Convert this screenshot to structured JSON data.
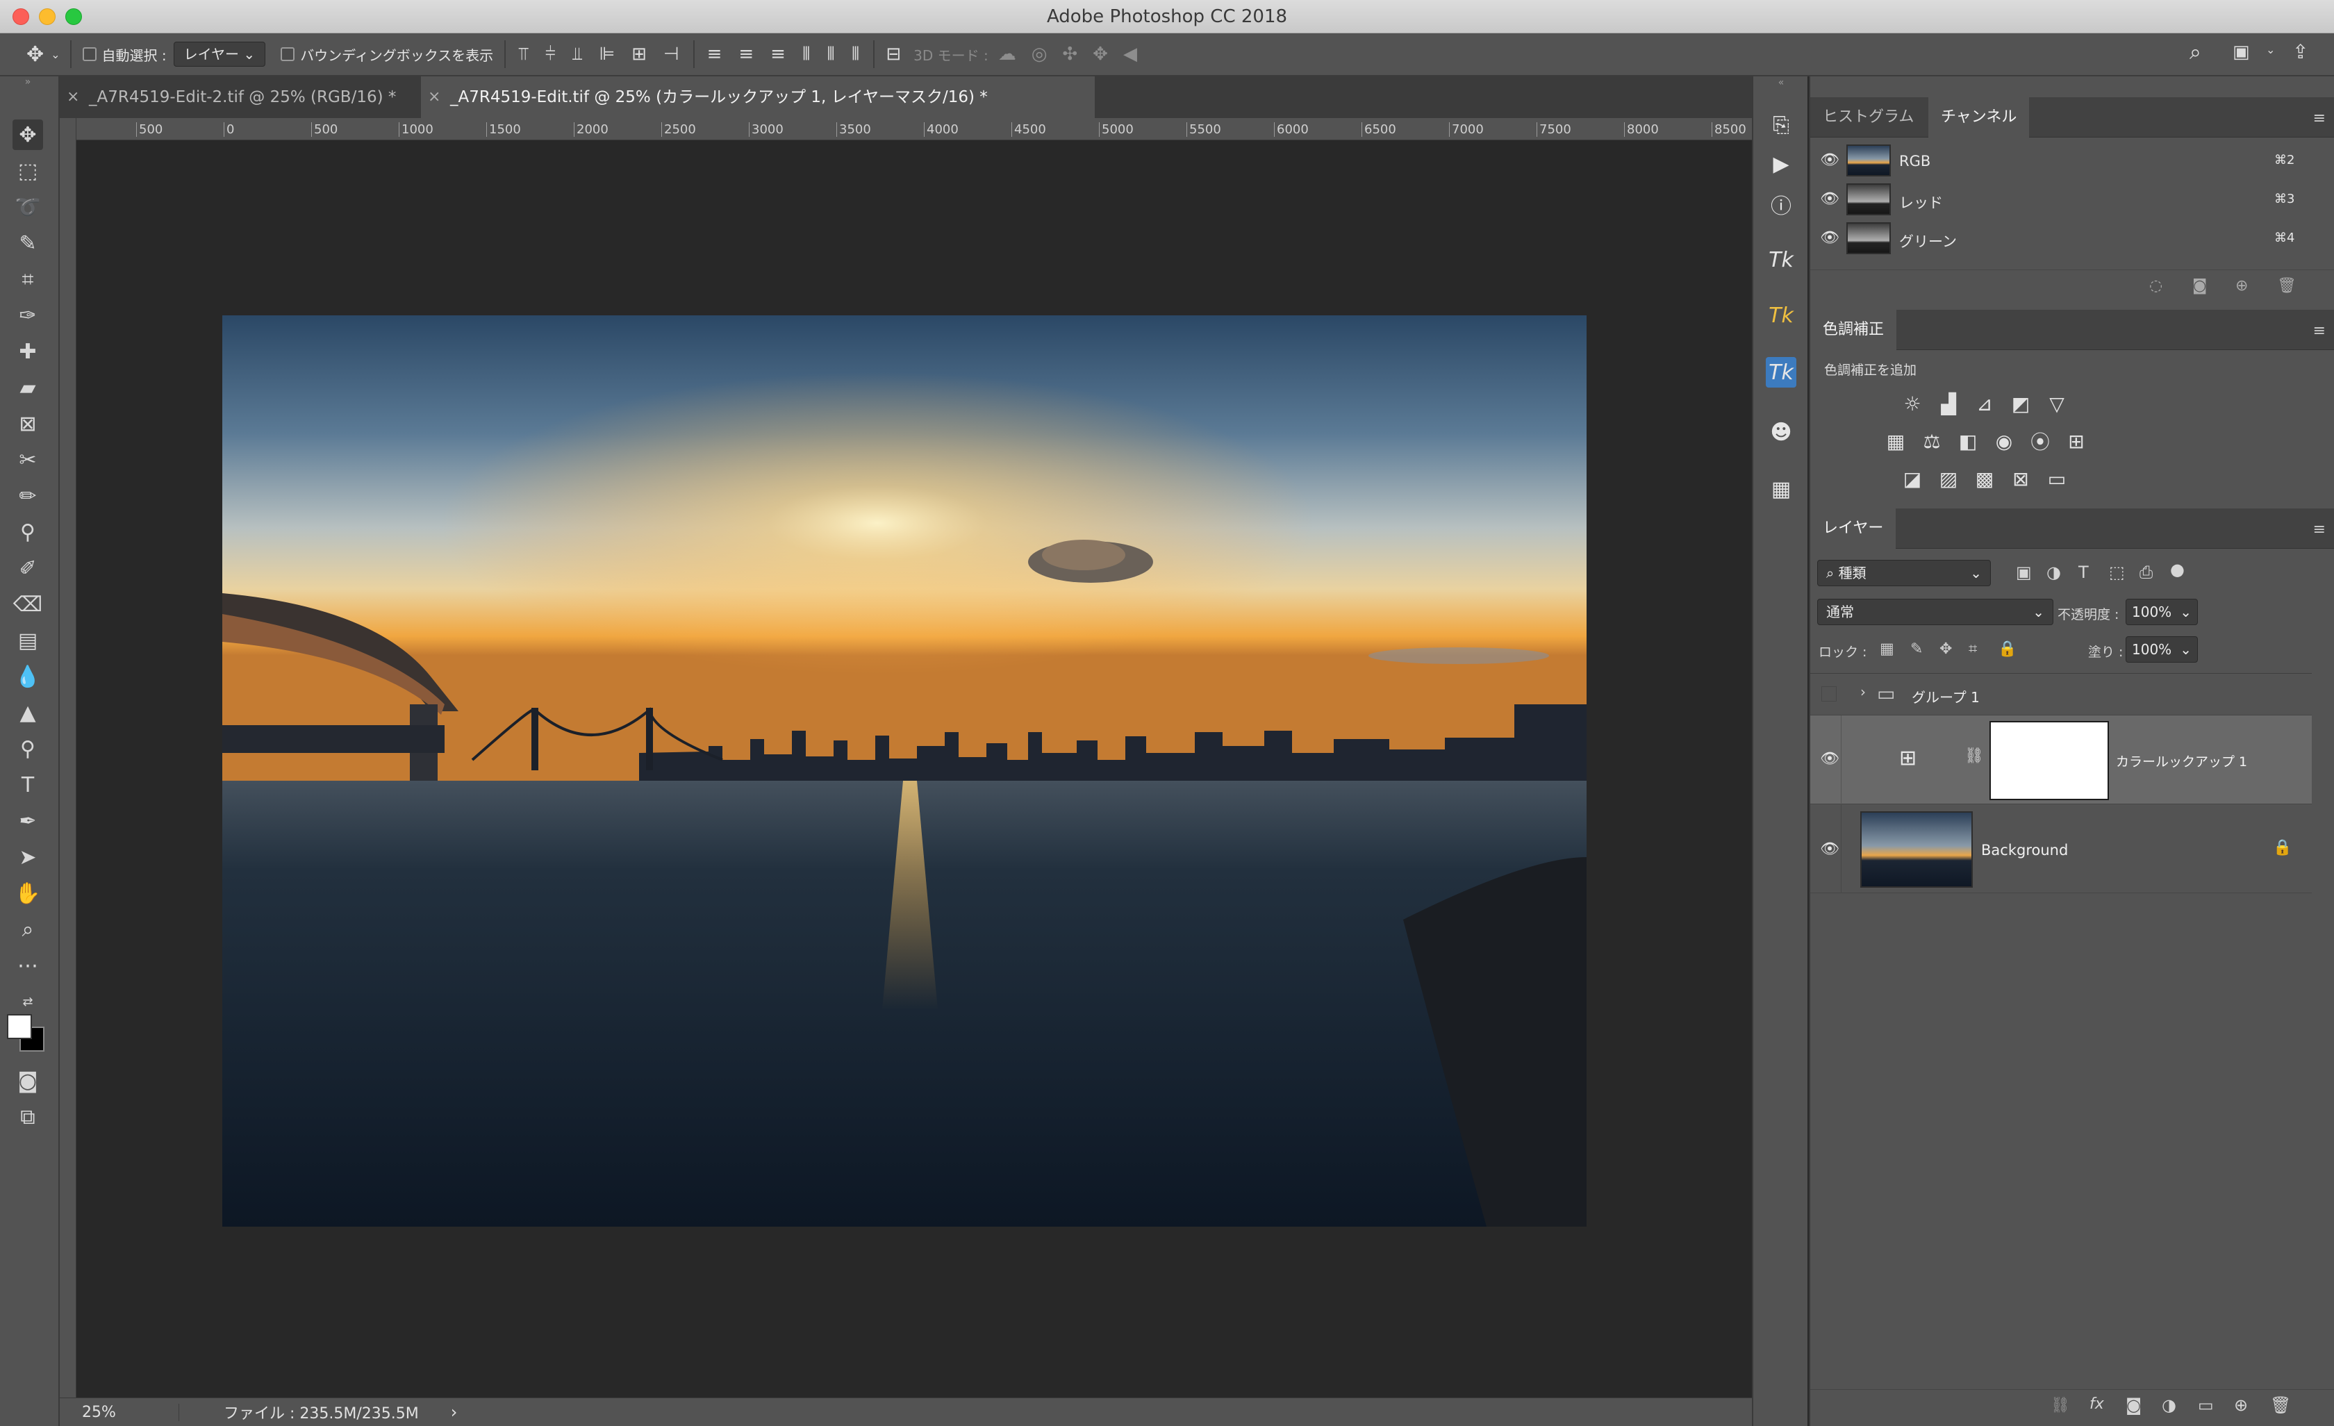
{
  "window": {
    "title": "Adobe Photoshop CC 2018"
  },
  "options": {
    "auto_select_label": "自動選択 :",
    "auto_select_value": "レイヤー",
    "bounding_box_label": "バウンディングボックスを表示",
    "mode_3d_label": "3D モード :"
  },
  "tabs": [
    {
      "label": "_A7R4519-Edit-2.tif @ 25% (RGB/16) *",
      "close": "×"
    },
    {
      "label": "_A7R4519-Edit.tif @ 25% (カラールックアップ 1, レイヤーマスク/16) *",
      "close": "×"
    }
  ],
  "ruler": {
    "ticks": [
      "500",
      "0",
      "500",
      "1000",
      "1500",
      "2000",
      "2500",
      "3000",
      "3500",
      "4000",
      "4500",
      "5000",
      "5500",
      "6000",
      "6500",
      "7000",
      "7500",
      "8000",
      "8500"
    ]
  },
  "status": {
    "zoom": "25%",
    "file_info": "ファイル : 235.5M/235.5M",
    "arrow": "›"
  },
  "channels_panel": {
    "tab_histogram": "ヒストグラム",
    "tab_channels": "チャンネル",
    "channels": [
      {
        "name": "RGB",
        "shortcut": "⌘2"
      },
      {
        "name": "レッド",
        "shortcut": "⌘3"
      },
      {
        "name": "グリーン",
        "shortcut": "⌘4"
      }
    ]
  },
  "adjustments_panel": {
    "title": "色調補正",
    "add_label": "色調補正を追加"
  },
  "layers_panel": {
    "title": "レイヤー",
    "filter_value": "種類",
    "blend_mode": "通常",
    "opacity_label": "不透明度 :",
    "opacity_value": "100%",
    "lock_label": "ロック :",
    "fill_label": "塗り :",
    "fill_value": "100%",
    "layers": [
      {
        "name": "グループ 1",
        "type": "group"
      },
      {
        "name": "カラールックアップ 1",
        "type": "adjustment"
      },
      {
        "name": "Background",
        "type": "image"
      }
    ]
  },
  "colors": {
    "ui_bg": "#535353",
    "canvas_bg": "#282828",
    "panel_header": "#424242"
  }
}
